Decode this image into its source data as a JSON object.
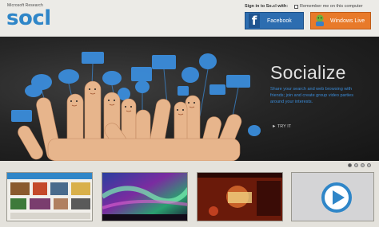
{
  "header": {
    "brand_small": "Microsoft Research",
    "logo_text": "socl",
    "signin_label": "Sign in to So.cl with:",
    "remember_label": "Remember me on this computer",
    "facebook_label": "Facebook",
    "windows_live_label": "Windows Live"
  },
  "hero": {
    "title": "Socialize",
    "description": "Share your search and web browsing with friends; join and create group video parties around your interests.",
    "link_text": "► TRY IT"
  },
  "carousel": {
    "dots": 4,
    "active_dot": 0,
    "thumbnails": [
      "search-collage",
      "aurora-photo",
      "red-media-page",
      "video-play"
    ]
  },
  "colors": {
    "accent": "#2f86c8",
    "facebook": "#2d6db0",
    "windows_live": "#e87a2a",
    "hero_bg": "#1c1c1c"
  }
}
